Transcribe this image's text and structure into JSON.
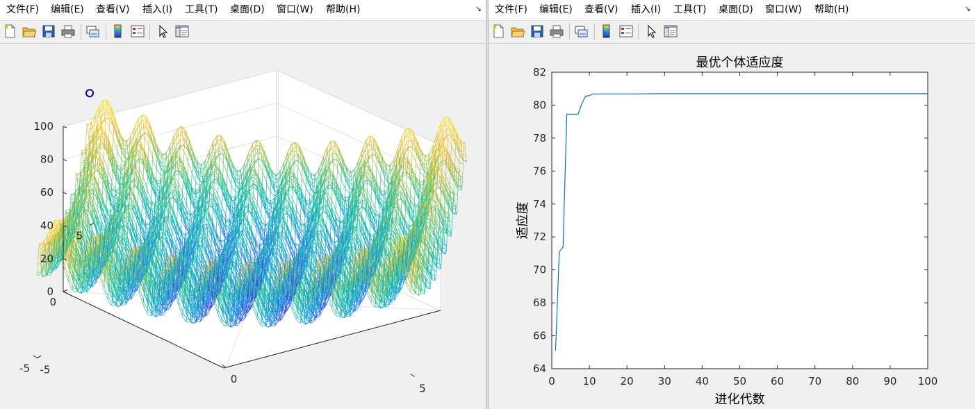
{
  "left_window": {
    "menu": [
      "文件(F)",
      "编辑(E)",
      "查看(V)",
      "插入(I)",
      "工具(T)",
      "桌面(D)",
      "窗口(W)",
      "帮助(H)"
    ],
    "dock_icon": "dock-arrow-icon",
    "toolbar_icons": [
      "new-figure-icon",
      "open-file-icon",
      "save-icon",
      "print-icon",
      "link-plot-icon",
      "colorbar-icon",
      "legend-icon",
      "pointer-icon",
      "property-editor-icon"
    ]
  },
  "right_window": {
    "menu": [
      "文件(F)",
      "编辑(E)",
      "查看(V)",
      "插入(I)",
      "工具(T)",
      "桌面(D)",
      "窗口(W)",
      "帮助(H)"
    ],
    "dock_icon": "dock-arrow-icon",
    "toolbar_icons": [
      "new-figure-icon",
      "open-file-icon",
      "save-icon",
      "print-icon",
      "link-plot-icon",
      "colorbar-icon",
      "legend-icon",
      "pointer-icon",
      "property-editor-icon"
    ]
  },
  "colors": {
    "line": "#0072BD",
    "marker": "#0000CC",
    "colormap": [
      "#3E26A8",
      "#3C62F7",
      "#1D9CDE",
      "#09BAB4",
      "#50C583",
      "#A6BF47",
      "#EEBE2F",
      "#F9DF1E"
    ]
  },
  "chart_data": [
    {
      "type": "surface",
      "mesh": true,
      "function": "20 + x^2 + y^2 - 10cos(2πx) - 10cos(2πy)",
      "x_ticks": [
        "-5",
        "0",
        "5"
      ],
      "y_ticks": [
        "-5",
        "0",
        "5"
      ],
      "z_ticks": [
        "0",
        "20",
        "40",
        "60",
        "80",
        "100"
      ],
      "xlim": [
        -5,
        5
      ],
      "ylim": [
        -5,
        5
      ],
      "zlim": [
        0,
        100
      ],
      "grid": true,
      "marker": {
        "x": -5,
        "y": 5,
        "z": 80,
        "shape": "circle"
      }
    },
    {
      "type": "line",
      "title": "最优个体适应度",
      "xlabel": "进化代数",
      "ylabel": "适应度",
      "xlim": [
        0,
        100
      ],
      "ylim": [
        64,
        82
      ],
      "x_ticks": [
        "0",
        "10",
        "20",
        "30",
        "40",
        "50",
        "60",
        "70",
        "80",
        "90",
        "100"
      ],
      "y_ticks": [
        "64",
        "66",
        "68",
        "70",
        "72",
        "74",
        "76",
        "78",
        "80",
        "82"
      ],
      "grid": false,
      "series": [
        {
          "x": [
            1,
            2,
            3,
            4,
            5,
            6,
            7,
            8,
            9,
            10,
            11,
            12,
            20,
            30,
            40,
            50,
            60,
            70,
            80,
            90,
            100
          ],
          "y": [
            65.1,
            71.1,
            71.4,
            79.45,
            79.45,
            79.45,
            79.45,
            80.1,
            80.55,
            80.58,
            80.68,
            80.68,
            80.68,
            80.7,
            80.7,
            80.7,
            80.7,
            80.7,
            80.7,
            80.7,
            80.7
          ]
        }
      ]
    }
  ]
}
